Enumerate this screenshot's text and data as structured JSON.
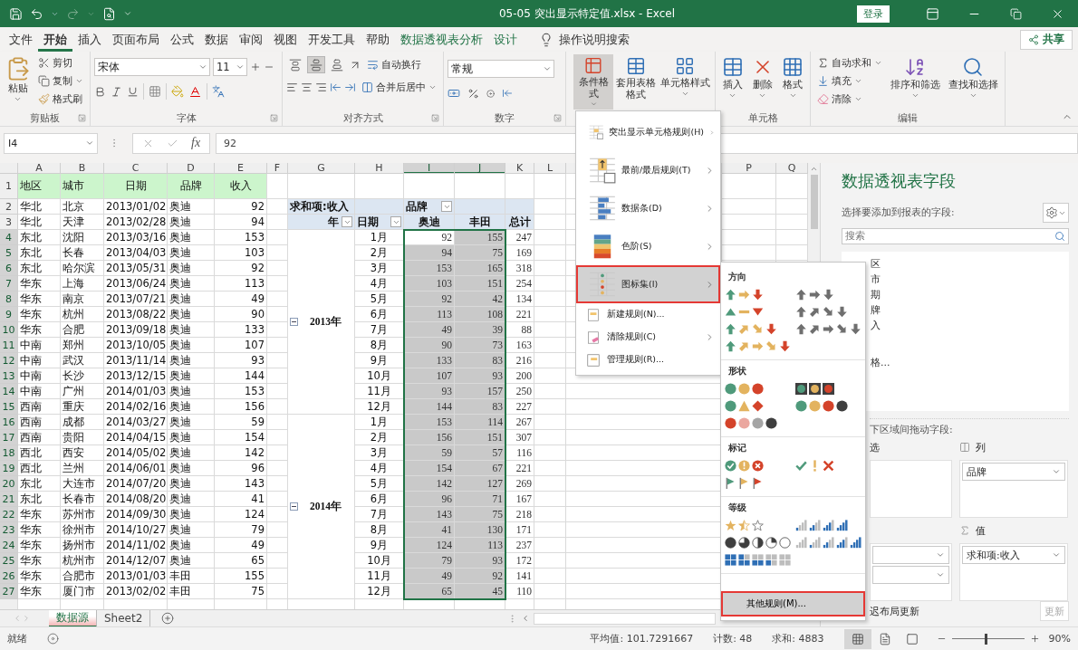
{
  "title_bar": {
    "title": "05-05 突出显示特定值.xlsx - Excel",
    "login": "登录"
  },
  "menu_tabs": [
    {
      "label": "文件",
      "selected": false,
      "contextual": false
    },
    {
      "label": "开始",
      "selected": true,
      "contextual": false
    },
    {
      "label": "插入",
      "selected": false,
      "contextual": false
    },
    {
      "label": "页面布局",
      "selected": false,
      "contextual": false
    },
    {
      "label": "公式",
      "selected": false,
      "contextual": false
    },
    {
      "label": "数据",
      "selected": false,
      "contextual": false
    },
    {
      "label": "审阅",
      "selected": false,
      "contextual": false
    },
    {
      "label": "视图",
      "selected": false,
      "contextual": false
    },
    {
      "label": "开发工具",
      "selected": false,
      "contextual": false
    },
    {
      "label": "帮助",
      "selected": false,
      "contextual": false
    },
    {
      "label": "数据透视表分析",
      "selected": false,
      "contextual": true
    },
    {
      "label": "设计",
      "selected": false,
      "contextual": true
    }
  ],
  "tell_me": "操作说明搜索",
  "share": "共享",
  "ribbon": {
    "clipboard": {
      "label": "剪贴板",
      "paste": "粘贴",
      "cut": "剪切",
      "copy": "复制",
      "format_painter": "格式刷"
    },
    "font": {
      "label": "字体",
      "font_name": "宋体",
      "font_size": "11"
    },
    "alignment": {
      "label": "对齐方式",
      "middle_align_pressed": true,
      "wrap_text": "自动换行",
      "merge_center": "合并后居中"
    },
    "number": {
      "label": "数字",
      "format": "常规"
    },
    "styles": {
      "conditional_formatting": {
        "label": "条件格式",
        "pressed": true
      },
      "format_as_table": "套用表格格式",
      "cell_styles": "单元格样式"
    },
    "cells": {
      "label": "单元格",
      "insert": "插入",
      "delete": "删除",
      "format": "格式"
    },
    "editing": {
      "label": "编辑",
      "autosum": "自动求和",
      "fill": "填充",
      "clear": "清除",
      "sort_filter": "排序和筛选",
      "find_select": "查找和选择"
    }
  },
  "formula_bar": {
    "name_box": "I4",
    "insert_function": "fx",
    "formula": "92"
  },
  "columns": [
    {
      "label": "A",
      "selected": false
    },
    {
      "label": "B",
      "selected": false
    },
    {
      "label": "C",
      "selected": false
    },
    {
      "label": "D",
      "selected": false
    },
    {
      "label": "E",
      "selected": false
    },
    {
      "label": "F",
      "selected": false
    },
    {
      "label": "G",
      "selected": false
    },
    {
      "label": "H",
      "selected": false
    },
    {
      "label": "I",
      "selected": true
    },
    {
      "label": "J",
      "selected": true
    },
    {
      "label": "K",
      "selected": false
    },
    {
      "label": "L",
      "selected": false
    },
    {
      "label": "P",
      "selected": false
    },
    {
      "label": "Q",
      "selected": false
    }
  ],
  "row_headers": [
    {
      "label": "1",
      "selected": false
    },
    {
      "label": "2",
      "selected": false
    },
    {
      "label": "3",
      "selected": false
    },
    {
      "label": "4",
      "selected": true
    },
    {
      "label": "5",
      "selected": true
    },
    {
      "label": "6",
      "selected": true
    },
    {
      "label": "7",
      "selected": true
    },
    {
      "label": "8",
      "selected": true
    },
    {
      "label": "9",
      "selected": true
    },
    {
      "label": "10",
      "selected": true
    },
    {
      "label": "11",
      "selected": true
    },
    {
      "label": "12",
      "selected": true
    },
    {
      "label": "13",
      "selected": true
    },
    {
      "label": "14",
      "selected": true
    },
    {
      "label": "15",
      "selected": true
    },
    {
      "label": "16",
      "selected": true
    },
    {
      "label": "17",
      "selected": true
    },
    {
      "label": "18",
      "selected": true
    },
    {
      "label": "19",
      "selected": true
    },
    {
      "label": "20",
      "selected": true
    },
    {
      "label": "21",
      "selected": true
    },
    {
      "label": "22",
      "selected": true
    },
    {
      "label": "23",
      "selected": true
    },
    {
      "label": "24",
      "selected": true
    },
    {
      "label": "25",
      "selected": true
    },
    {
      "label": "26",
      "selected": true
    },
    {
      "label": "27",
      "selected": true
    }
  ],
  "data_table": {
    "header": [
      "地区",
      "城市",
      "日期",
      "品牌",
      "收入"
    ],
    "rows": [
      [
        "华北",
        "北京",
        "2013/01/02",
        "奥迪",
        "92"
      ],
      [
        "华北",
        "天津",
        "2013/02/28",
        "奥迪",
        "94"
      ],
      [
        "东北",
        "沈阳",
        "2013/03/16",
        "奥迪",
        "153"
      ],
      [
        "东北",
        "长春",
        "2013/04/03",
        "奥迪",
        "103"
      ],
      [
        "东北",
        "哈尔滨",
        "2013/05/31",
        "奥迪",
        "92"
      ],
      [
        "华东",
        "上海",
        "2013/06/24",
        "奥迪",
        "113"
      ],
      [
        "华东",
        "南京",
        "2013/07/21",
        "奥迪",
        "49"
      ],
      [
        "华东",
        "杭州",
        "2013/08/22",
        "奥迪",
        "90"
      ],
      [
        "华东",
        "合肥",
        "2013/09/18",
        "奥迪",
        "133"
      ],
      [
        "中南",
        "郑州",
        "2013/10/05",
        "奥迪",
        "107"
      ],
      [
        "中南",
        "武汉",
        "2013/11/14",
        "奥迪",
        "93"
      ],
      [
        "中南",
        "长沙",
        "2013/12/15",
        "奥迪",
        "144"
      ],
      [
        "中南",
        "广州",
        "2014/01/03",
        "奥迪",
        "153"
      ],
      [
        "西南",
        "重庆",
        "2014/02/16",
        "奥迪",
        "156"
      ],
      [
        "西南",
        "成都",
        "2014/03/27",
        "奥迪",
        "59"
      ],
      [
        "西南",
        "贵阳",
        "2014/04/15",
        "奥迪",
        "154"
      ],
      [
        "西北",
        "西安",
        "2014/05/02",
        "奥迪",
        "142"
      ],
      [
        "西北",
        "兰州",
        "2014/06/01",
        "奥迪",
        "96"
      ],
      [
        "东北",
        "大连市",
        "2014/07/20",
        "奥迪",
        "143"
      ],
      [
        "东北",
        "长春市",
        "2014/08/20",
        "奥迪",
        "41"
      ],
      [
        "华东",
        "苏州市",
        "2014/09/30",
        "奥迪",
        "124"
      ],
      [
        "华东",
        "徐州市",
        "2014/10/27",
        "奥迪",
        "79"
      ],
      [
        "华东",
        "扬州市",
        "2014/11/02",
        "奥迪",
        "49"
      ],
      [
        "华东",
        "杭州市",
        "2014/12/07",
        "奥迪",
        "65"
      ],
      [
        "华东",
        "合肥市",
        "2013/01/03",
        "丰田",
        "155"
      ],
      [
        "华东",
        "厦门市",
        "2013/02/02",
        "丰田",
        "75"
      ]
    ]
  },
  "pivot": {
    "value_field": "求和项:收入",
    "column_field": "品牌",
    "row_field_1": "年",
    "row_field_2": "日期",
    "columns": [
      "奥迪",
      "丰田",
      "总计"
    ],
    "selected": true,
    "groups": [
      {
        "label": "2013年",
        "expanded": true,
        "rows": [
          {
            "month": "1月",
            "values": [
              "92",
              "155",
              "247"
            ]
          },
          {
            "month": "2月",
            "values": [
              "94",
              "75",
              "169"
            ]
          },
          {
            "month": "3月",
            "values": [
              "153",
              "165",
              "318"
            ]
          },
          {
            "month": "4月",
            "values": [
              "103",
              "151",
              "254"
            ]
          },
          {
            "month": "5月",
            "values": [
              "92",
              "42",
              "134"
            ]
          },
          {
            "month": "6月",
            "values": [
              "113",
              "108",
              "221"
            ]
          },
          {
            "month": "7月",
            "values": [
              "49",
              "39",
              "88"
            ]
          },
          {
            "month": "8月",
            "values": [
              "90",
              "73",
              "163"
            ]
          },
          {
            "month": "9月",
            "values": [
              "133",
              "83",
              "216"
            ]
          },
          {
            "month": "10月",
            "values": [
              "107",
              "93",
              "200"
            ]
          },
          {
            "month": "11月",
            "values": [
              "93",
              "157",
              "250"
            ]
          },
          {
            "month": "12月",
            "values": [
              "144",
              "83",
              "227"
            ]
          }
        ]
      },
      {
        "label": "2014年",
        "expanded": true,
        "rows": [
          {
            "month": "1月",
            "values": [
              "153",
              "114",
              "267"
            ]
          },
          {
            "month": "2月",
            "values": [
              "156",
              "151",
              "307"
            ]
          },
          {
            "month": "3月",
            "values": [
              "59",
              "57",
              "116"
            ]
          },
          {
            "month": "4月",
            "values": [
              "154",
              "67",
              "221"
            ]
          },
          {
            "month": "5月",
            "values": [
              "142",
              "127",
              "269"
            ]
          },
          {
            "month": "6月",
            "values": [
              "96",
              "71",
              "167"
            ]
          },
          {
            "month": "7月",
            "values": [
              "143",
              "75",
              "218"
            ]
          },
          {
            "month": "8月",
            "values": [
              "41",
              "130",
              "171"
            ]
          },
          {
            "month": "9月",
            "values": [
              "124",
              "113",
              "237"
            ]
          },
          {
            "month": "10月",
            "values": [
              "79",
              "93",
              "172"
            ]
          },
          {
            "month": "11月",
            "values": [
              "49",
              "92",
              "141"
            ]
          },
          {
            "month": "12月",
            "values": [
              "65",
              "45",
              "110"
            ]
          }
        ]
      }
    ]
  },
  "sheet_tabs": [
    {
      "label": "数据源",
      "selected": true
    },
    {
      "label": "Sheet2",
      "selected": false
    }
  ],
  "status_bar": {
    "ready": "就绪",
    "average": "平均值: 101.7291667",
    "count": "计数: 48",
    "sum": "求和: 4883",
    "views": [
      {
        "kind": "normal",
        "selected": true
      },
      {
        "kind": "page_layout",
        "selected": false
      },
      {
        "kind": "page_break",
        "selected": false
      }
    ],
    "zoom": {
      "level": 0.46,
      "label": "90%"
    }
  },
  "field_pane": {
    "title": "数据透视表字段",
    "subtitle": "选择要添加到报表的字段:",
    "search_placeholder": "搜索",
    "field_fragments": [
      "区",
      "市",
      "期",
      "牌",
      "入"
    ],
    "more_tables_fragment": "格...",
    "drag_hint_fragment": "下区域间拖动字段:",
    "filter_fragment": "选",
    "columns_title": "列",
    "columns_items": [
      "品牌"
    ],
    "rows_items": [
      {
        "kind": "field"
      },
      {
        "kind": "field"
      }
    ],
    "values_title": "值",
    "values_items": [
      "求和项:收入"
    ],
    "defer_fragment": "迟布局更新",
    "update_button": {
      "label": "更新",
      "disabled": true
    }
  },
  "conditional_format_menu": {
    "items": [
      {
        "label": "突出显示单元格规则(H)",
        "kind": "highlight",
        "submenu": true,
        "selected": false
      },
      {
        "label": "最前/最后规则(T)",
        "kind": "top_bottom",
        "submenu": true,
        "selected": false
      },
      {
        "label": "数据条(D)",
        "kind": "data_bars",
        "submenu": true,
        "selected": false
      },
      {
        "label": "色阶(S)",
        "kind": "color_scales",
        "submenu": true,
        "selected": false
      },
      {
        "label": "图标集(I)",
        "kind": "icon_sets",
        "submenu": true,
        "selected": true
      },
      {
        "label": "新建规则(N)...",
        "kind": "new_rule",
        "submenu": false,
        "selected": false
      },
      {
        "label": "清除规则(C)",
        "kind": "clear_rules",
        "submenu": true,
        "selected": false
      },
      {
        "label": "管理规则(R)...",
        "kind": "manage_rules",
        "submenu": false,
        "selected": false
      }
    ]
  },
  "icon_sets_menu": {
    "sections": [
      {
        "title": "方向",
        "options": [
          {
            "kind": "arrows3_color"
          },
          {
            "kind": "arrows3_grey"
          },
          {
            "kind": "triangles3"
          },
          {
            "kind": "arrows4_grey"
          },
          {
            "kind": "arrows4_color"
          },
          {
            "kind": "arrows5_grey"
          },
          {
            "kind": "arrows5_color"
          }
        ]
      },
      {
        "title": "形状",
        "options": [
          {
            "kind": "lights3"
          },
          {
            "kind": "lights3_rimmed"
          },
          {
            "kind": "signs3"
          },
          {
            "kind": "lights4"
          },
          {
            "kind": "red_to_black4"
          }
        ]
      },
      {
        "title": "标记",
        "options": [
          {
            "kind": "symbols3_circled"
          },
          {
            "kind": "symbols3"
          },
          {
            "kind": "flags3"
          }
        ]
      },
      {
        "title": "等级",
        "options": [
          {
            "kind": "stars3"
          },
          {
            "kind": "bars4"
          },
          {
            "kind": "quarters5"
          },
          {
            "kind": "bars5"
          },
          {
            "kind": "boxes5"
          }
        ]
      }
    ],
    "more_rules": {
      "label": "其他规则(M)...",
      "selected": true
    }
  }
}
